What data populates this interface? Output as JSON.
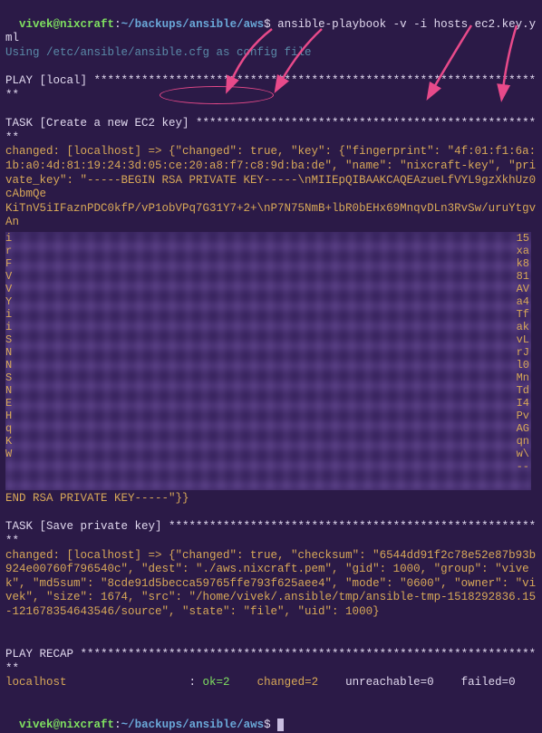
{
  "prompt1": {
    "user": "vivek",
    "at": "@",
    "host": "nixcraft",
    "colon": ":",
    "path": "~/backups/ansible/aws",
    "dollar": "$",
    "command": "ansible-playbook -v -i hosts ec2.key.yml"
  },
  "config_line": "Using /etc/ansible/ansible.cfg as config file",
  "play_local": "PLAY [local] *******************************************************************",
  "task_create": "TASK [Create a new EC2 key] ****************************************************",
  "changed1_prefix": "changed: [localhost] => ",
  "changed1_json": "{\"changed\": true, \"key\": {\"fingerprint\": \"4f:01:f1:6a:1b:a0:4d:81:19:24:3d:05:ce:20:a8:f7:c8:9d:ba:de\", \"name\": \"nixcraft-key\", \"private_key\": \"-----BEGIN RSA PRIVATE KEY-----\\nMIIEpQIBAAKCAQEAzueLfVYL9gzXkhUz0cAbmQe",
  "censored_first": "KiTnV5iIFaznPDC0kfP/vP1obVPq7G31Y7+2+\\nP7N75NmB+lbR0bEHx69MnqvDLn3RvSw/uruYtgvAn",
  "censored_left_chars": "i\nr\nF\nV\nV\nY\ni\ni\nS\nN\nN\nS\nN\nE\nH\nq\nK\nW",
  "censored_right_chars": "15\nxa\nk8\n81\nAV\na4\nTf\nak\nvL\nrJ\nl0\nMn\nTd\nI4\nPv\nAG\nqn\nw\\\n--",
  "end_key": "END RSA PRIVATE KEY-----\"}}",
  "task_save": "TASK [Save private key] ********************************************************",
  "changed2_prefix": "changed: [localhost] => ",
  "changed2_json": "{\"changed\": true, \"checksum\": \"6544dd91f2c78e52e87b93b924e00760f796540c\", \"dest\": \"./aws.nixcraft.pem\", \"gid\": 1000, \"group\": \"vivek\", \"md5sum\": \"8cde91d5becca59765ffe793f625aee4\", \"mode\": \"0600\", \"owner\": \"vivek\", \"size\": 1674, \"src\": \"/home/vivek/.ansible/tmp/ansible-tmp-1518292836.15-121678354643546/source\", \"state\": \"file\", \"uid\": 1000}",
  "play_recap": "PLAY RECAP *********************************************************************",
  "recap": {
    "host": "localhost",
    "sep": "                  : ",
    "ok": "ok=2",
    "sp1": "    ",
    "changed": "changed=2",
    "sp2": "    ",
    "unreachable": "unreachable=0",
    "sp3": "    ",
    "failed": "failed=0"
  },
  "prompt2": {
    "user": "vivek",
    "at": "@",
    "host": "nixcraft",
    "colon": ":",
    "path": "~/backups/ansible/aws",
    "dollar": "$"
  }
}
